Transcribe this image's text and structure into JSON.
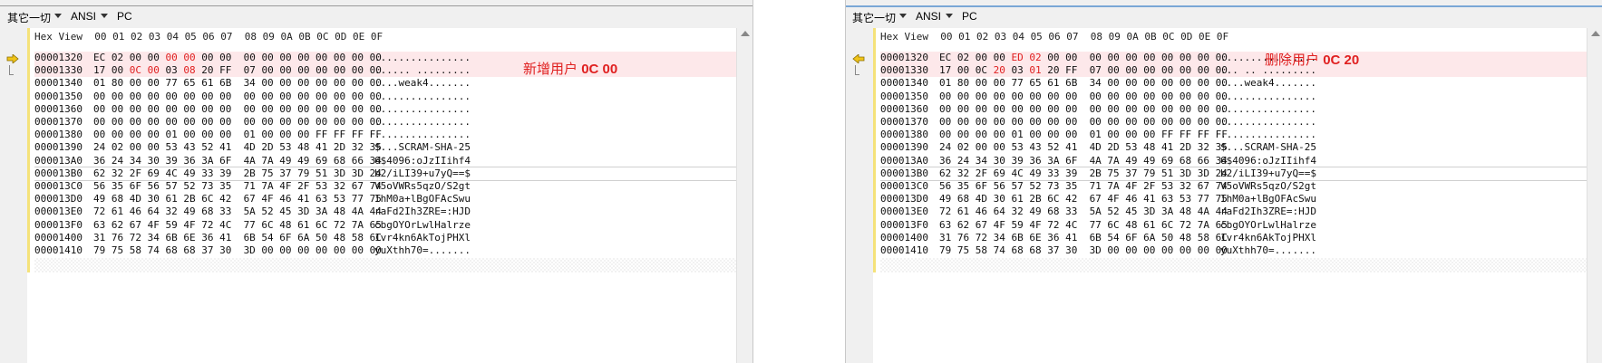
{
  "panes": {
    "left": {
      "toolbar": {
        "codepage": "其它一切",
        "encoding": "ANSI",
        "platform": "PC"
      },
      "header": "Hex View  00 01 02 03 04 05 06 07  08 09 0A 0B 0C 0D 0E 0F",
      "annotation": {
        "text": "新增用户",
        "bold": "0C 00"
      },
      "rows": [
        {
          "off": "00001320",
          "hex": [
            "EC 02 00 00 ",
            "00 00",
            " 00 00  00 00 00 00 00 00 00 00"
          ],
          "asc": "................"
        },
        {
          "off": "00001330",
          "hex": [
            "17 00 ",
            "0C 00",
            " 03 ",
            "08",
            " 20 FF  07 00 00 00 00 00 00 00"
          ],
          "asc": "...... ........."
        },
        {
          "off": "00001340",
          "hex": [
            "01 80 00 00 77 65 61 6B  34 00 00 00 00 00 00 00"
          ],
          "asc": "....weak4......."
        },
        {
          "off": "00001350",
          "hex": [
            "00 00 00 00 00 00 00 00  00 00 00 00 00 00 00 00"
          ],
          "asc": "................"
        },
        {
          "off": "00001360",
          "hex": [
            "00 00 00 00 00 00 00 00  00 00 00 00 00 00 00 00"
          ],
          "asc": "................"
        },
        {
          "off": "00001370",
          "hex": [
            "00 00 00 00 00 00 00 00  00 00 00 00 00 00 00 00"
          ],
          "asc": "................"
        },
        {
          "off": "00001380",
          "hex": [
            "00 00 00 00 01 00 00 00  01 00 00 00 FF FF FF FF"
          ],
          "asc": "................"
        },
        {
          "off": "00001390",
          "hex": [
            "24 02 00 00 53 43 52 41  4D 2D 53 48 41 2D 32 35"
          ],
          "asc": "$...SCRAM-SHA-25"
        },
        {
          "off": "000013A0",
          "hex": [
            "36 24 34 30 39 36 3A 6F  4A 7A 49 49 69 68 66 34"
          ],
          "asc": "6$4096:oJzIIihf4"
        },
        {
          "off": "000013B0",
          "hex": [
            "62 32 2F 69 4C 49 33 39  2B 75 37 79 51 3D 3D 24"
          ],
          "asc": "b2/iLI39+u7yQ==$"
        },
        {
          "off": "000013C0",
          "hex": [
            "56 35 6F 56 57 52 73 35  71 7A 4F 2F 53 32 67 74"
          ],
          "asc": "V5oVWRs5qzO/S2gt"
        },
        {
          "off": "000013D0",
          "hex": [
            "49 68 4D 30 61 2B 6C 42  67 4F 46 41 63 53 77 75"
          ],
          "asc": "IhM0a+lBgOFAcSwu"
        },
        {
          "off": "000013E0",
          "hex": [
            "72 61 46 64 32 49 68 33  5A 52 45 3D 3A 48 4A 44"
          ],
          "asc": "raFd2Ih3ZRE=:HJD"
        },
        {
          "off": "000013F0",
          "hex": [
            "63 62 67 4F 59 4F 72 4C  77 6C 48 61 6C 72 7A 65"
          ],
          "asc": "cbgOYOrLwlHalrze"
        },
        {
          "off": "00001400",
          "hex": [
            "31 76 72 34 6B 6E 36 41  6B 54 6F 6A 50 48 58 6C"
          ],
          "asc": "1vr4kn6AkTojPHXl"
        },
        {
          "off": "00001410",
          "hex": [
            "79 75 58 74 68 68 37 30  3D 00 00 00 00 00 00 00"
          ],
          "asc": "yuXthh70=......."
        }
      ]
    },
    "right": {
      "toolbar": {
        "codepage": "其它一切",
        "encoding": "ANSI",
        "platform": "PC"
      },
      "header": "Hex View  00 01 02 03 04 05 06 07  08 09 0A 0B 0C 0D 0E 0F",
      "annotation": {
        "text": "删除用户",
        "bold": "0C 20"
      },
      "rows": [
        {
          "off": "00001320",
          "hex": [
            "EC 02 00 00 ",
            "ED 02",
            " 00 00  00 00 00 00 00 00 00 00"
          ],
          "asc": "................"
        },
        {
          "off": "00001330",
          "hex": [
            "17 00 0C ",
            "20",
            " 03 ",
            "01",
            " 20 FF  07 00 00 00 00 00 00 00"
          ],
          "asc": "... .. ........."
        },
        {
          "off": "00001340",
          "hex": [
            "01 80 00 00 77 65 61 6B  34 00 00 00 00 00 00 00"
          ],
          "asc": "....weak4......."
        },
        {
          "off": "00001350",
          "hex": [
            "00 00 00 00 00 00 00 00  00 00 00 00 00 00 00 00"
          ],
          "asc": "................"
        },
        {
          "off": "00001360",
          "hex": [
            "00 00 00 00 00 00 00 00  00 00 00 00 00 00 00 00"
          ],
          "asc": "................"
        },
        {
          "off": "00001370",
          "hex": [
            "00 00 00 00 00 00 00 00  00 00 00 00 00 00 00 00"
          ],
          "asc": "................"
        },
        {
          "off": "00001380",
          "hex": [
            "00 00 00 00 01 00 00 00  01 00 00 00 FF FF FF FF"
          ],
          "asc": "................"
        },
        {
          "off": "00001390",
          "hex": [
            "24 02 00 00 53 43 52 41  4D 2D 53 48 41 2D 32 35"
          ],
          "asc": "$...SCRAM-SHA-25"
        },
        {
          "off": "000013A0",
          "hex": [
            "36 24 34 30 39 36 3A 6F  4A 7A 49 49 69 68 66 34"
          ],
          "asc": "6$4096:oJzIIihf4"
        },
        {
          "off": "000013B0",
          "hex": [
            "62 32 2F 69 4C 49 33 39  2B 75 37 79 51 3D 3D 24"
          ],
          "asc": "b2/iLI39+u7yQ==$"
        },
        {
          "off": "000013C0",
          "hex": [
            "56 35 6F 56 57 52 73 35  71 7A 4F 2F 53 32 67 74"
          ],
          "asc": "V5oVWRs5qzO/S2gt"
        },
        {
          "off": "000013D0",
          "hex": [
            "49 68 4D 30 61 2B 6C 42  67 4F 46 41 63 53 77 75"
          ],
          "asc": "IhM0a+lBgOFAcSwu"
        },
        {
          "off": "000013E0",
          "hex": [
            "72 61 46 64 32 49 68 33  5A 52 45 3D 3A 48 4A 44"
          ],
          "asc": "raFd2Ih3ZRE=:HJD"
        },
        {
          "off": "000013F0",
          "hex": [
            "63 62 67 4F 59 4F 72 4C  77 6C 48 61 6C 72 7A 65"
          ],
          "asc": "cbgOYOrLwlHalrze"
        },
        {
          "off": "00001400",
          "hex": [
            "31 76 72 34 6B 6E 36 41  6B 54 6F 6A 50 48 58 6C"
          ],
          "asc": "1vr4kn6AkTojPHXl"
        },
        {
          "off": "00001410",
          "hex": [
            "79 75 58 74 68 68 37 30  3D 00 00 00 00 00 00 00"
          ],
          "asc": "yuXthh70=......."
        }
      ]
    }
  },
  "colors": {
    "highlight_row": "#fde8ea",
    "changed_byte": "#e02020",
    "annotation": "#e02020",
    "marker_bar": "#f5e27a"
  },
  "icons": {
    "current_line": "arrow-right-icon"
  }
}
